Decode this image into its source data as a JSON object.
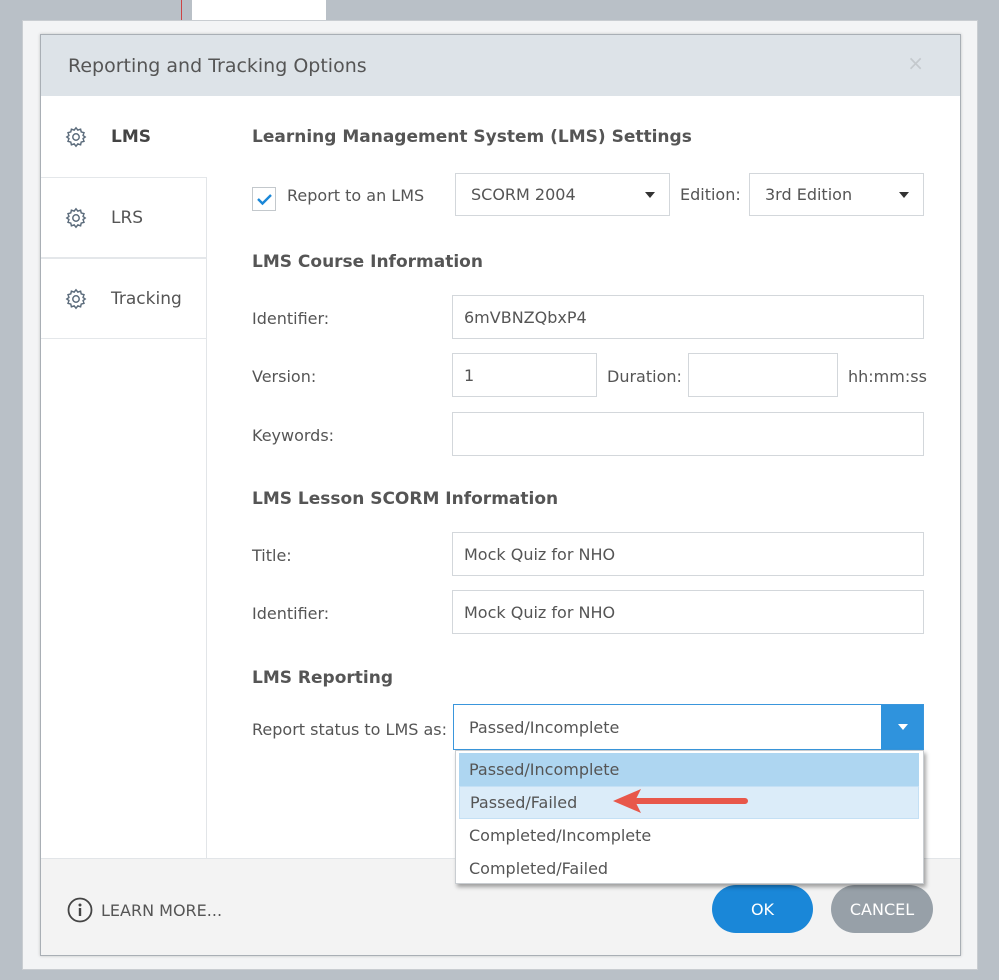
{
  "dialog": {
    "title": "Reporting and Tracking Options",
    "close_icon": "×"
  },
  "sidebar": {
    "items": [
      {
        "label": "LMS"
      },
      {
        "label": "LRS"
      },
      {
        "label": "Tracking"
      }
    ]
  },
  "lms_settings": {
    "heading": "Learning Management System (LMS) Settings",
    "report_label": "Report to an LMS",
    "report_checked": true,
    "standard": "SCORM 2004",
    "edition_label": "Edition:",
    "edition": "3rd Edition"
  },
  "course": {
    "heading": "LMS Course Information",
    "identifier_label": "Identifier:",
    "identifier": "6mVBNZQbxP4",
    "version_label": "Version:",
    "version": "1",
    "duration_label": "Duration:",
    "duration": "",
    "duration_unit": "hh:mm:ss",
    "keywords_label": "Keywords:",
    "keywords": ""
  },
  "lesson": {
    "heading": "LMS Lesson SCORM Information",
    "title_label": "Title:",
    "title": "Mock Quiz for NHO",
    "identifier_label": "Identifier:",
    "identifier": "Mock Quiz for NHO"
  },
  "reporting": {
    "heading": "LMS Reporting",
    "status_label": "Report status to LMS as:",
    "status_value": "Passed/Incomplete",
    "options": [
      "Passed/Incomplete",
      "Passed/Failed",
      "Completed/Incomplete",
      "Completed/Failed"
    ]
  },
  "footer": {
    "learn_more": "LEARN MORE...",
    "ok": "OK",
    "cancel": "CANCEL"
  },
  "colors": {
    "accent": "#1a87d8",
    "arrow": "#e8574a"
  }
}
